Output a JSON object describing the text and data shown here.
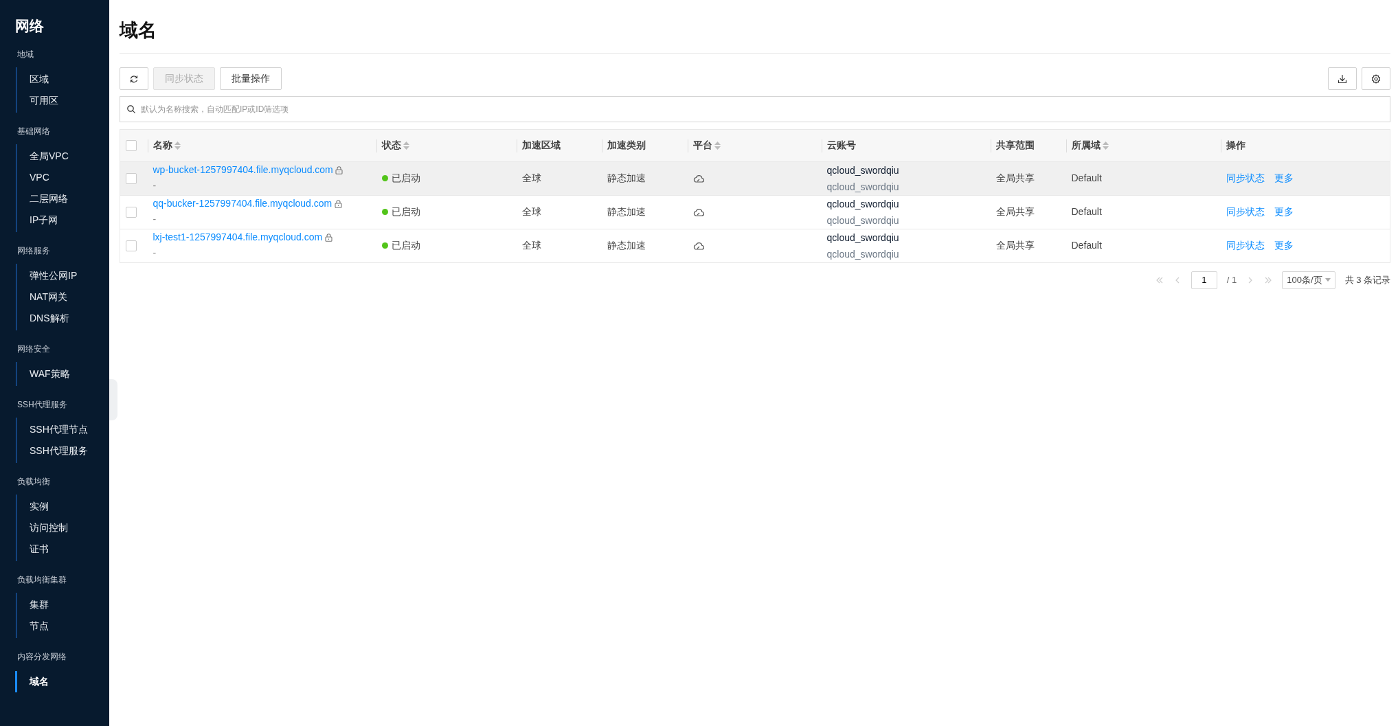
{
  "sidebar": {
    "title": "网络",
    "groups": [
      {
        "label": "地域",
        "items": [
          {
            "label": "区域",
            "selected": false
          },
          {
            "label": "可用区",
            "selected": false
          }
        ]
      },
      {
        "label": "基础网络",
        "items": [
          {
            "label": "全局VPC",
            "selected": false
          },
          {
            "label": "VPC",
            "selected": false
          },
          {
            "label": "二层网络",
            "selected": false
          },
          {
            "label": "IP子网",
            "selected": false
          }
        ]
      },
      {
        "label": "网络服务",
        "items": [
          {
            "label": "弹性公网IP",
            "selected": false
          },
          {
            "label": "NAT网关",
            "selected": false
          },
          {
            "label": "DNS解析",
            "selected": false
          }
        ]
      },
      {
        "label": "网络安全",
        "items": [
          {
            "label": "WAF策略",
            "selected": false
          }
        ]
      },
      {
        "label": "SSH代理服务",
        "items": [
          {
            "label": "SSH代理节点",
            "selected": false
          },
          {
            "label": "SSH代理服务",
            "selected": false
          }
        ]
      },
      {
        "label": "负载均衡",
        "items": [
          {
            "label": "实例",
            "selected": false
          },
          {
            "label": "访问控制",
            "selected": false
          },
          {
            "label": "证书",
            "selected": false
          }
        ]
      },
      {
        "label": "负载均衡集群",
        "items": [
          {
            "label": "集群",
            "selected": false
          },
          {
            "label": "节点",
            "selected": false
          }
        ]
      },
      {
        "label": "内容分发网络",
        "items": [
          {
            "label": "域名",
            "selected": true
          }
        ]
      }
    ]
  },
  "page_title": "域名",
  "toolbar": {
    "buttons": [
      {
        "kind": "refresh",
        "disabled": false
      },
      {
        "kind": "text",
        "label": "同步状态",
        "disabled": true
      },
      {
        "kind": "text",
        "label": "批量操作",
        "disabled": false
      }
    ],
    "right_buttons": [
      {
        "kind": "download"
      },
      {
        "kind": "settings"
      }
    ]
  },
  "search": {
    "placeholder": "默认为名称搜索，自动匹配IP或ID筛选项"
  },
  "table": {
    "select_all_checked": false,
    "columns": [
      {
        "label": "名称",
        "sortable": true
      },
      {
        "label": "状态",
        "sortable": true
      },
      {
        "label": "加速区域",
        "sortable": false
      },
      {
        "label": "加速类别",
        "sortable": false
      },
      {
        "label": "平台",
        "sortable": true
      },
      {
        "label": "云账号",
        "sortable": false
      },
      {
        "label": "共享范围",
        "sortable": false
      },
      {
        "label": "所属域",
        "sortable": true
      },
      {
        "label": "操作",
        "sortable": false
      }
    ],
    "rows": [
      {
        "checked": false,
        "hovered": true,
        "name": "wp-bucket-1257997404.file.myqcloud.com",
        "sub": "-",
        "status": "已启动",
        "color": "#52c41a",
        "region": "全球",
        "type": "静态加速",
        "account": "qcloud_swordqiu",
        "account_sub": "qcloud_swordqiu",
        "share": "全局共享",
        "domain": "Default",
        "actions": [
          "同步状态",
          "更多"
        ]
      },
      {
        "checked": false,
        "hovered": false,
        "name": "qq-bucker-1257997404.file.myqcloud.com",
        "sub": "-",
        "status": "已启动",
        "color": "#52c41a",
        "region": "全球",
        "type": "静态加速",
        "account": "qcloud_swordqiu",
        "account_sub": "qcloud_swordqiu",
        "share": "全局共享",
        "domain": "Default",
        "actions": [
          "同步状态",
          "更多"
        ]
      },
      {
        "checked": false,
        "hovered": false,
        "name": "lxj-test1-1257997404.file.myqcloud.com",
        "sub": "-",
        "status": "已启动",
        "color": "#52c41a",
        "region": "全球",
        "type": "静态加速",
        "account": "qcloud_swordqiu",
        "account_sub": "qcloud_swordqiu",
        "share": "全局共享",
        "domain": "Default",
        "actions": [
          "同步状态",
          "更多"
        ]
      }
    ]
  },
  "pagination": {
    "page": "1",
    "total_pages": "/ 1",
    "page_size": "100条/页",
    "total": "共 3 条记录"
  }
}
